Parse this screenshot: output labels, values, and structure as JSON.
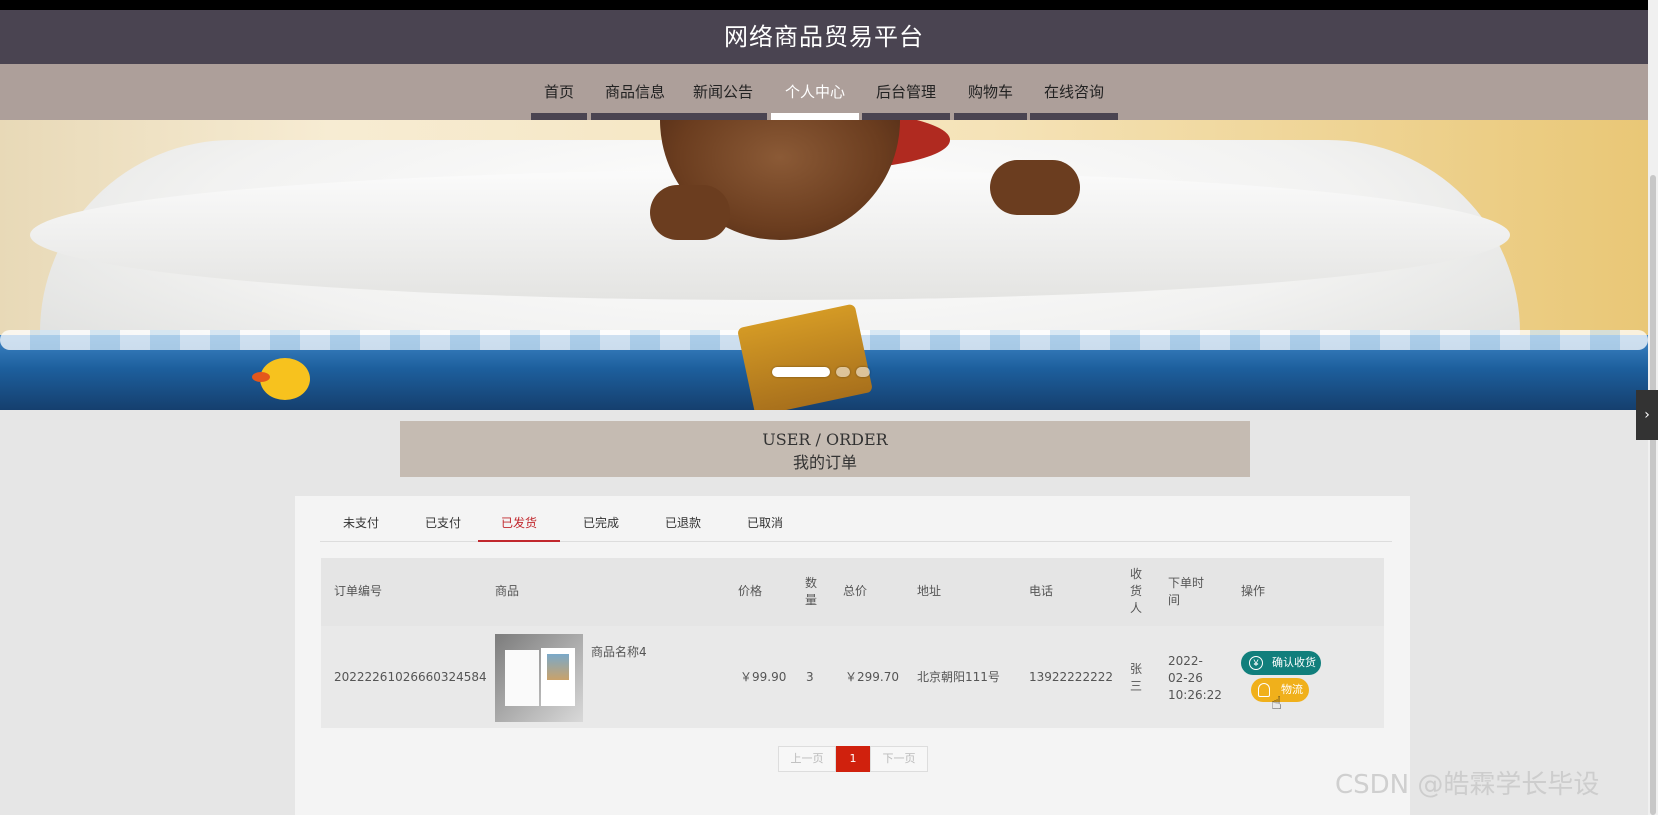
{
  "header": {
    "title": "网络商品贸易平台"
  },
  "nav": {
    "items": [
      {
        "label": "首页",
        "active": false
      },
      {
        "label": "商品信息",
        "active": false
      },
      {
        "label": "新闻公告",
        "active": false
      },
      {
        "label": "个人中心",
        "active": true
      },
      {
        "label": "后台管理",
        "active": false
      },
      {
        "label": "购物车",
        "active": false
      },
      {
        "label": "在线咨询",
        "active": false
      }
    ]
  },
  "banner": {
    "slide_count": 3,
    "active_slide": 1
  },
  "section": {
    "title_en": "USER / ORDER",
    "title_cn": "我的订单"
  },
  "tabs": [
    {
      "label": "未支付",
      "active": false
    },
    {
      "label": "已支付",
      "active": false
    },
    {
      "label": "已发货",
      "active": true
    },
    {
      "label": "已完成",
      "active": false
    },
    {
      "label": "已退款",
      "active": false
    },
    {
      "label": "已取消",
      "active": false
    }
  ],
  "table": {
    "headers": {
      "order_no": "订单编号",
      "product": "商品",
      "price": "价格",
      "qty_1": "数",
      "qty_2": "量",
      "total": "总价",
      "address": "地址",
      "phone": "电话",
      "receiver_1": "收",
      "receiver_2": "货",
      "receiver_3": "人",
      "time_1": "下单时",
      "time_2": "间",
      "action": "操作"
    },
    "rows": [
      {
        "order_no": "20222261026660324584",
        "product_name": "商品名称4",
        "price": "￥99.90",
        "qty": "3",
        "total": "￥299.70",
        "address": "北京朝阳111号",
        "phone": "13922222222",
        "receiver_1": "张",
        "receiver_2": "三",
        "time_1": "2022-",
        "time_2": "02-26",
        "time_3": "10:26:22",
        "confirm_label": "确认收货",
        "logistics_label": "物流"
      }
    ]
  },
  "pager": {
    "prev": "上一页",
    "current": "1",
    "next": "下一页"
  },
  "watermark": "CSDN @皓霖学长毕设",
  "colors": {
    "header_bg": "#4a4451",
    "nav_bg": "#ad9f9a",
    "active_tab": "#c1272d",
    "confirm_btn": "#117f7c",
    "logistics_btn": "#f0b01b",
    "pager_current": "#d0210d"
  }
}
